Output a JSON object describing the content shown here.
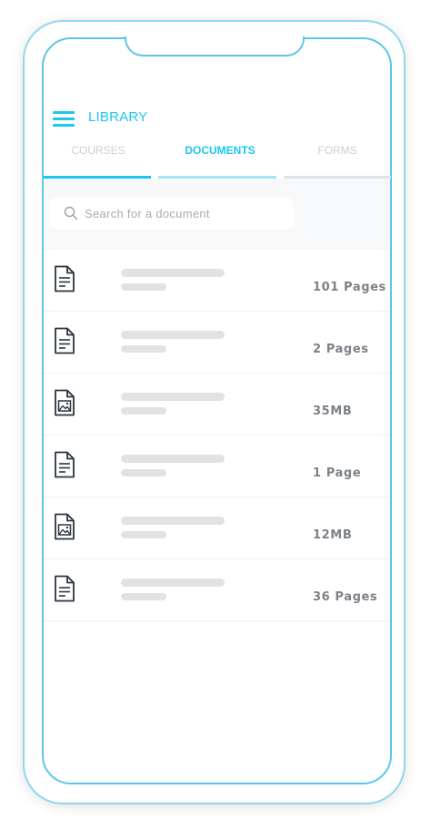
{
  "header": {
    "title": "LIBRARY",
    "menu_icon": "hamburger-menu-icon"
  },
  "tabs": [
    {
      "label": "COURSES",
      "active": false
    },
    {
      "label": "DOCUMENTS",
      "active": true
    },
    {
      "label": "FORMS",
      "active": false
    }
  ],
  "search": {
    "placeholder": "Search for a document",
    "value": "",
    "icon": "search-icon"
  },
  "documents": [
    {
      "type": "text-document",
      "size": "101 Pages"
    },
    {
      "type": "text-document",
      "size": "2 Pages"
    },
    {
      "type": "image-document",
      "size": "35MB"
    },
    {
      "type": "text-document",
      "size": "1 Page"
    },
    {
      "type": "image-document",
      "size": "12MB"
    },
    {
      "type": "text-document",
      "size": "36 Pages"
    }
  ],
  "colors": {
    "accent": "#1cc7ef",
    "frame": "#5bc6ea",
    "inactive_tab": "#c9cfd4",
    "placeholder_bar": "#e0e2e4",
    "size_text": "#7c8288",
    "icon_stroke": "#2b3440"
  }
}
